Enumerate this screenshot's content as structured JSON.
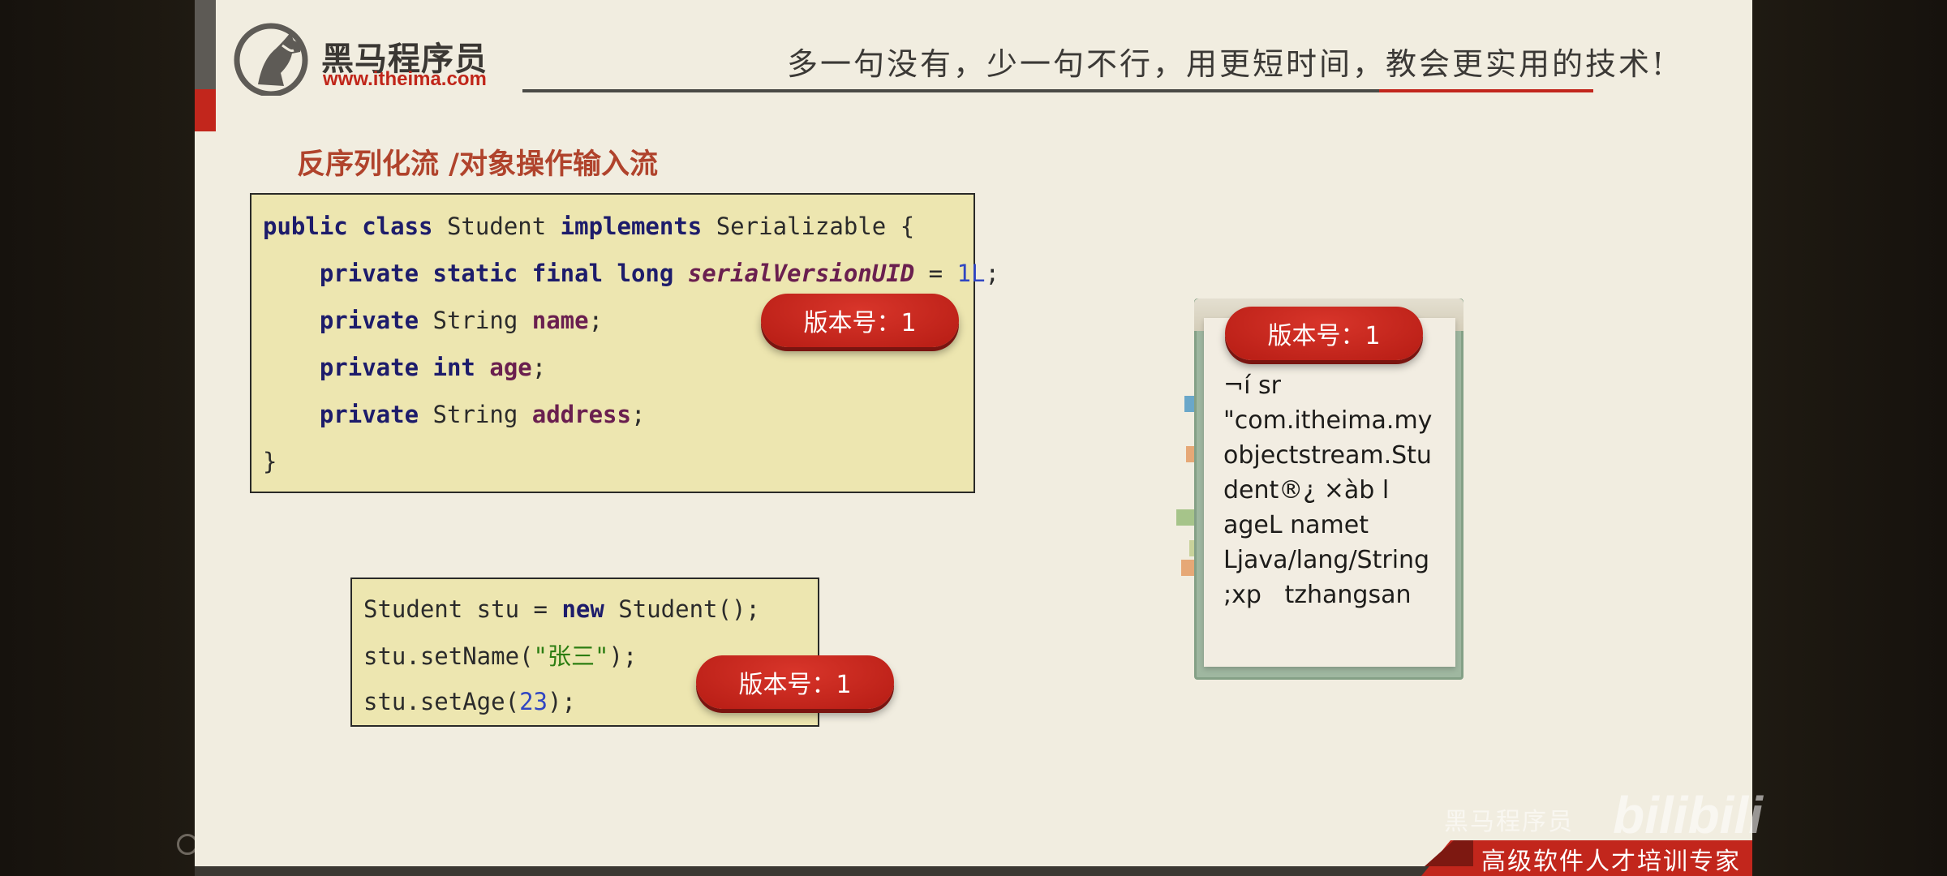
{
  "header": {
    "brand_name": "黑马程序员",
    "brand_url": "www.itheima.com",
    "slogan": "多一句没有，少一句不行，用更短时间，教会更实用的技术!"
  },
  "section_title": "反序列化流 /对象操作输入流",
  "code_class": {
    "l1_a": "public class",
    "l1_b": " Student ",
    "l1_c": "implements",
    "l1_d": " Serializable {",
    "l2_a": "    private static final long",
    "l2_b": " ",
    "l2_c": "serialVersionUID",
    "l2_d": " = ",
    "l2_e": "1L",
    "l2_f": ";",
    "l3_a": "    private",
    "l3_b": " String ",
    "l3_c": "name",
    "l3_d": ";",
    "l4_a": "    private int",
    "l4_b": " ",
    "l4_c": "age",
    "l4_d": ";",
    "l5_a": "    private",
    "l5_b": " String ",
    "l5_c": "address",
    "l5_d": ";",
    "l6": "}"
  },
  "code_usage": {
    "l1_a": "Student stu = ",
    "l1_b": "new",
    "l1_c": " Student();",
    "l2_a": "stu.setName(",
    "l2_b": "\"张三\"",
    "l2_c": ");",
    "l3_a": "stu.setAge(",
    "l3_b": "23",
    "l3_c": ");"
  },
  "badges": {
    "class_version": "版本号：1",
    "object_version": "版本号：1",
    "file_version": "版本号：1"
  },
  "serialized_file": {
    "lines": [
      "¬í sr",
      "\"com.itheima.my",
      "objectstream.Stu",
      "dent®¿ ×àb l",
      "ageL namet",
      "Ljava/lang/String",
      ";xp   tzhangsan"
    ]
  },
  "footer": {
    "tagline": "高级软件人才培训专家"
  },
  "watermark": {
    "text": "黑马程序员",
    "logo": "bilibili"
  },
  "colors": {
    "accent_red": "#c2261c",
    "slide_bg": "#f1ede0",
    "code_bg": "#ede6b0",
    "title_color": "#b0432c"
  }
}
